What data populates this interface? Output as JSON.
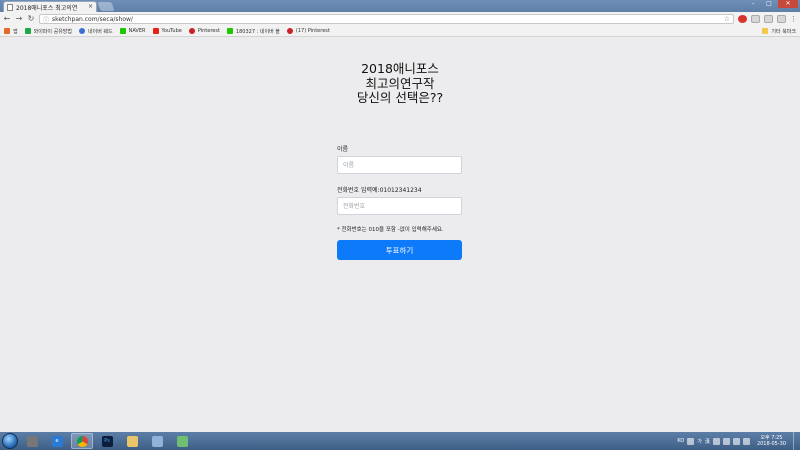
{
  "browser": {
    "tab_title": "2018애니포스 최고의연",
    "tab_close": "×",
    "url": "sketchpan.com/seca/show/",
    "bookmarks": [
      {
        "label": "앱",
        "color": "#e36b2a"
      },
      {
        "label": "와이파이 공유방법",
        "color": "#1fa84a"
      },
      {
        "label": "네이버 웨드",
        "color": "#3b6fd6"
      },
      {
        "label": "NAVER",
        "color": "#1ec800"
      },
      {
        "label": "YouTube",
        "color": "#e62117"
      },
      {
        "label": "Pinterest",
        "color": "#cb2027"
      },
      {
        "label": "180327 : 네이버 블",
        "color": "#1ec800"
      },
      {
        "label": "(17) Pinterest",
        "color": "#cb2027"
      }
    ],
    "other_bookmarks": "기타 북마크"
  },
  "form": {
    "title": "2018애니포스\n최고의연구작\n당신의 선택은??",
    "name_label": "이름",
    "name_placeholder": "이름",
    "phone_label": "전화번호 입력예:01012341234",
    "phone_placeholder": "전화번호",
    "hint": "* 전화번호는 010을 포함 -없이 입력해주세요.",
    "vote_button": "투표하기"
  },
  "taskbar": {
    "ime_label": "가",
    "lang": "漢",
    "time": "오후 7:25",
    "date": "2018-05-30"
  },
  "colors": {
    "primary_button": "#0d7bf9",
    "page_background": "#ececee"
  }
}
